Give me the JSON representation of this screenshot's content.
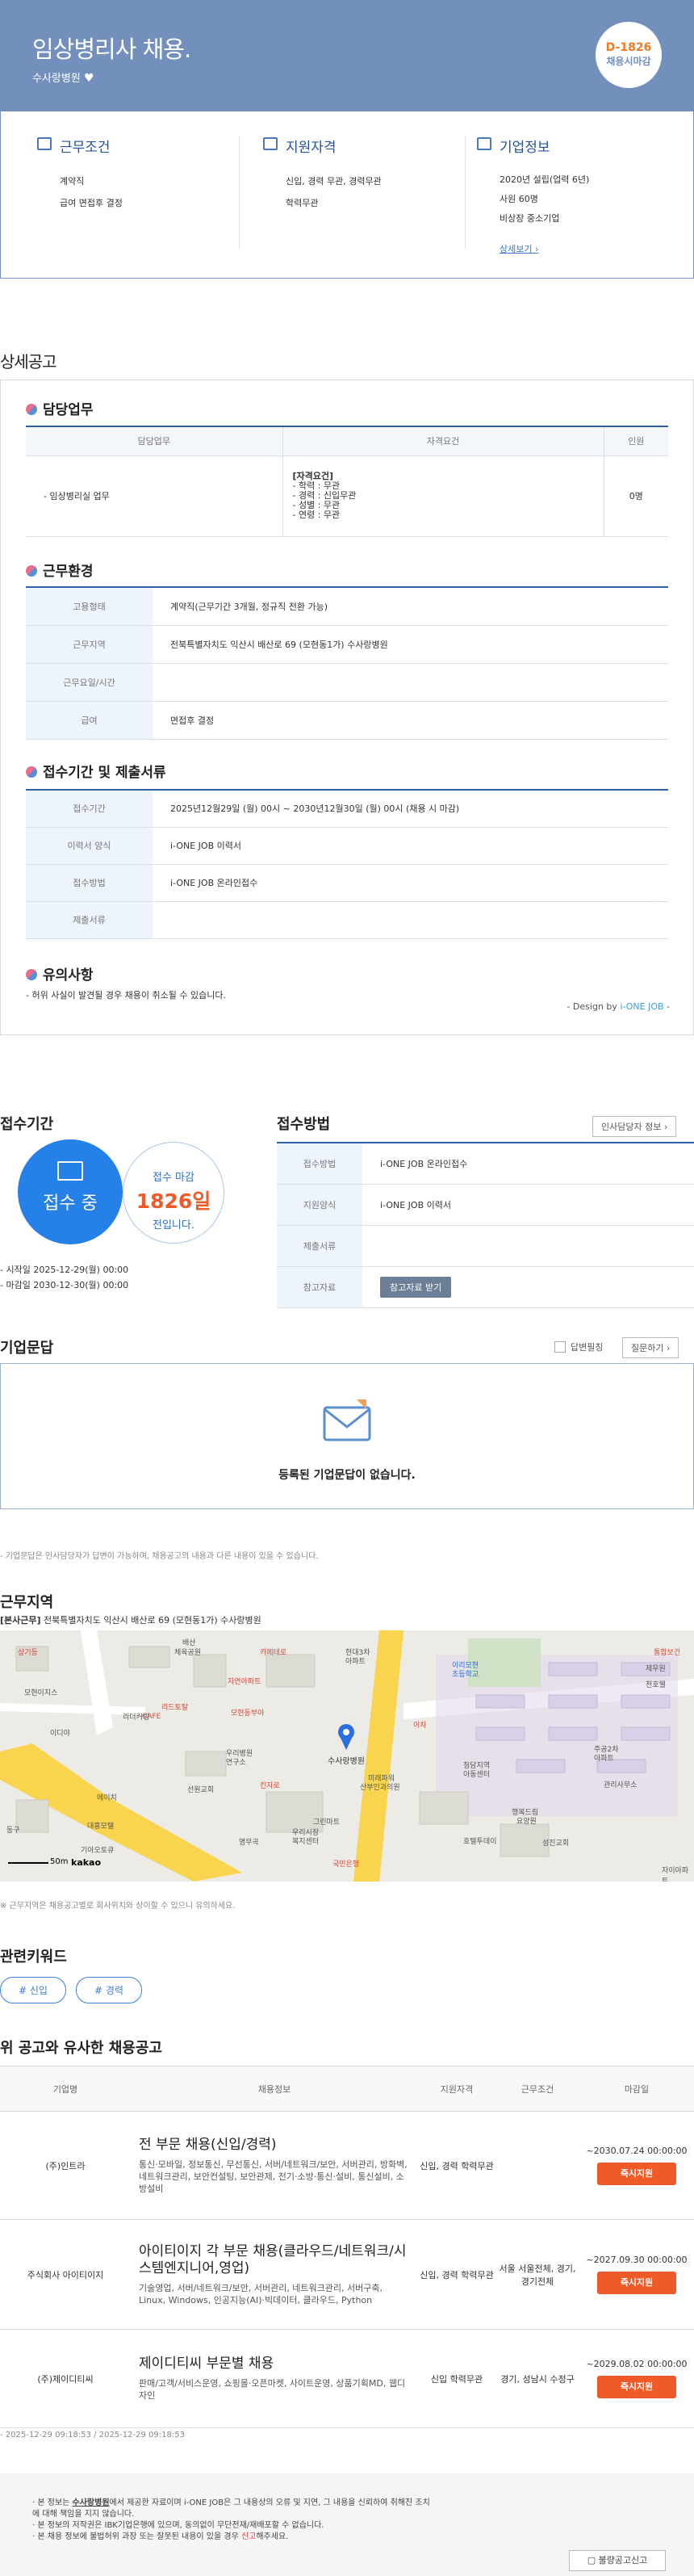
{
  "header": {
    "title": "임상병리사 채용.",
    "company": "수사랑병원",
    "dday": "D-1826",
    "status": "채용시마감"
  },
  "summary": {
    "work": {
      "title": "근무조건",
      "lines": [
        "계약직",
        "급여 면접후 결정"
      ]
    },
    "qual": {
      "title": "지원자격",
      "lines": [
        "신입, 경력 무관, 경력무관",
        "학력무관"
      ]
    },
    "comp": {
      "title": "기업정보",
      "lines": [
        "2020년 설립(업력 6년)",
        "사원 60명",
        "비상장 중소기업"
      ],
      "more": "상세보기 ›"
    }
  },
  "detail": {
    "heading": "상세공고",
    "duty": {
      "title": "담당업무",
      "headers": [
        "담당업무",
        "자격요건",
        "인원"
      ],
      "row": {
        "task": "- 임상병리실 업무",
        "req_title": "[자격요건]",
        "reqs": [
          "- 학력 : 무관",
          "- 경력 : 신입무관",
          "- 성별 : 무관",
          "- 연령 : 무관"
        ],
        "count": "0명"
      }
    },
    "env": {
      "title": "근무환경",
      "rows": [
        {
          "label": "고용형태",
          "value": "계약직(근무기간 3개월, 정규직 전환 가능)"
        },
        {
          "label": "근무지역",
          "value": "전북특별자치도 익산시 배산로 69 (모현동1가) 수사랑병원"
        },
        {
          "label": "근무요일/시간",
          "value": ""
        },
        {
          "label": "급여",
          "value": "면접후 결정"
        }
      ]
    },
    "apply": {
      "title": "접수기간 및 제출서류",
      "rows": [
        {
          "label": "접수기간",
          "value": "2025년12월29일 (월) 00시 ~ 2030년12월30일 (월) 00시 (채용 시 마감)"
        },
        {
          "label": "이력서 양식",
          "value": "i-ONE JOB 이력서"
        },
        {
          "label": "접수방법",
          "value": "i-ONE JOB 온라인접수"
        },
        {
          "label": "제출서류",
          "value": ""
        }
      ]
    },
    "notice": {
      "title": "유의사항",
      "text": "- 허위 사실이 발견될 경우 채용이 취소될 수 있습니다.",
      "design_prefix": "- Design by ",
      "design_brand": "i-ONE JOB",
      "design_suffix": " -"
    }
  },
  "period": {
    "title": "접수기간",
    "ing": "접수 중",
    "deadline_label": "접수 마감",
    "days": "1826일",
    "before": "전입니다.",
    "start": "- 시작일 2025-12-29(월) 00:00",
    "end": "- 마감일 2030-12-30(월) 00:00"
  },
  "method": {
    "title": "접수방법",
    "manager_button": "인사담당자 정보 ›",
    "rows": [
      {
        "label": "접수방법",
        "value": "i-ONE JOB 온라인접수"
      },
      {
        "label": "지원양식",
        "value": "i-ONE JOB 이력서"
      },
      {
        "label": "제출서류",
        "value": ""
      },
      {
        "label": "참고자료",
        "value": ""
      }
    ],
    "attach_button": "참고자료 받기"
  },
  "qa": {
    "title": "기업문답",
    "answered_label": "답변필칭",
    "ask_button": "질문하기 ›",
    "empty": "등록된 기업문답이 없습니다.",
    "note": "- 기업문답은 인사담당자가 답변이 가능하며, 채용공고의 내용과 다른 내용이 있을 수 있습니다."
  },
  "area": {
    "title": "근무지역",
    "tag": "[본사근무]",
    "address": " 전북특별자치도 익산시 배산로 69 (모현동1가) 수사랑병원",
    "pin_label": "수사랑병원",
    "scale": "50m",
    "kakao": "kakao",
    "note": "※ 근무지역은 채용공고별로 회사위치와 상이할 수 있으니 유의하세요.",
    "map_labels": [
      "배산",
      "체육공원",
      "카페테로",
      "현대3차",
      "아파트",
      "이리모현",
      "초등학교",
      "상기등",
      "모현이지스",
      "자연아파트",
      "CAFE",
      "리드토탈",
      "리더커빙",
      "모현동부아",
      "우리병원",
      "연구소",
      "선원교회",
      "기아오토큐",
      "명무곡",
      "킨자로",
      "우리시장",
      "복지센터",
      "미래파워",
      "산부인과의원",
      "청담지역",
      "아동센터",
      "행복드림",
      "요양원",
      "주공2차",
      "아파트",
      "관리사무소",
      "성진교회",
      "호텔투데이",
      "이차",
      "통합보건",
      "제우원",
      "천호웰",
      "동구",
      "대흥모텔",
      "이디야",
      "국민은행",
      "그린마트",
      "에이치",
      "자이아파트"
    ]
  },
  "keywords": {
    "title": "관련키워드",
    "items": [
      "# 신입",
      "# 경력"
    ]
  },
  "similar": {
    "title": "위 공고와 유사한 채용공고",
    "headers": [
      "기업명",
      "채용정보",
      "지원자격",
      "근무조건",
      "마감일"
    ],
    "rows": [
      {
        "company": "(주)인트라",
        "title": "전 부문 채용(신입/경력)",
        "desc": "통신·모바일, 정보통신, 무선통신, 서버/네트워크/보안, 서버관리, 방화벽, 네트워크관리, 보안컨설팅, 보안관제, 전기·소방·통신·설비, 통신설비, 소방설비",
        "qual": "신입, 경력 학력무관",
        "cond": "",
        "deadline": "~2030.07.24 00:00:00",
        "apply": "즉시지원"
      },
      {
        "company": "주식회사 아이티이지",
        "title": "아이티이지 각 부문 채용(클라우드/네트워크/시스템엔지니어,영업)",
        "desc": "기술영업, 서버/네트워크/보안, 서버관리, 네트워크관리, 서버구축, Linux, Windows, 인공지능(AI)·빅데이터, 클라우드, Python",
        "qual": "신입, 경력 학력무관",
        "cond": "서울 서울전체, 경기, 경기전체",
        "deadline": "~2027.09.30 00:00:00",
        "apply": "즉시지원"
      },
      {
        "company": "(주)제이디티씨",
        "title": "제이디티씨 부문별 채용",
        "desc": "판매/고객/서비스운영, 쇼핑몰·오픈마켓, 사이트운영, 상품기획MD, 웹디자인",
        "qual": "신입 학력무관",
        "cond": "경기, 성남시 수정구",
        "deadline": "~2029.08.02 00:00:00",
        "apply": "즉시지원"
      }
    ],
    "dates": "- 2025-12-29 09:18:53 / 2025-12-29 09:18:53"
  },
  "footer": {
    "lines": [
      {
        "pre": "본 정보는 ",
        "bold": "수사랑병원",
        "post": "에서 제공한 자료이며 i-ONE JOB은 그 내용상의 오류 및 지연, 그 내용을 신뢰하여 취해진 조치에 대해 책임을 지지 않습니다."
      },
      {
        "pre": "본 정보의 저작권은 IBK기업은행에 있으며, 동의없이 무단전재/재배포할 수 없습니다.",
        "bold": "",
        "post": ""
      },
      {
        "pre": "본 채용 정보에 불법허위 과장 또는 잘못된 내용이 있을 경우 ",
        "red": "신고",
        "post": "해주세요."
      }
    ],
    "report_button": "불량공고신고"
  },
  "colors": {
    "header": "#7390bd",
    "accent": "#2f5fa6",
    "orange": "#f05a28",
    "circle": "#2580e8"
  }
}
